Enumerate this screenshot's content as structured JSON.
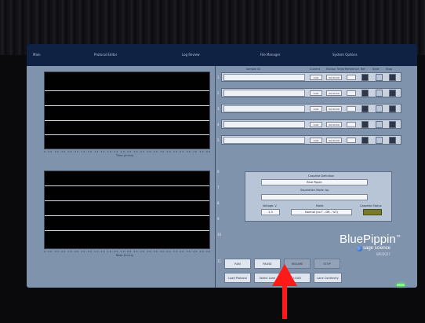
{
  "menu": {
    "items": [
      {
        "label": "Main"
      },
      {
        "label": "Protocol Editor"
      },
      {
        "label": "Log Review"
      },
      {
        "label": "File Manager"
      },
      {
        "label": "System Options"
      }
    ]
  },
  "plots": {
    "top_axis_labels": "0:00 03:20 06:40 10:00 13:20 16:40 20:00 23:20 26:40 30:00 33:20 36:40 40:00",
    "top_axis_title": "Time (h:m:s)",
    "bottom_axis_labels": "0:00 03:20 06:40 10:00 13:20 16:40 20:00 23:20 26:40 30:00 33:20 36:40 40:00",
    "bottom_axis_title": "Base (h:m:s)"
  },
  "lanes": {
    "headers": {
      "sample": "Sample ID",
      "current": "Current",
      "elution": "Elution Timer",
      "reference": "Reference",
      "ref": "Ref",
      "start": "Start",
      "stop": "Stop"
    },
    "numbers": [
      "1",
      "2",
      "3",
      "4",
      "5"
    ],
    "rows": [
      {
        "current": "0.00",
        "timer": "00:00:00"
      },
      {
        "current": "0.00",
        "timer": "00:00:00"
      },
      {
        "current": "0.00",
        "timer": "00:00:00"
      },
      {
        "current": "0.00",
        "timer": "00:00:00"
      },
      {
        "current": "0.00",
        "timer": "00:00:00"
      }
    ]
  },
  "lower_lane_numbers": [
    "6",
    "7",
    "8",
    "9",
    "10",
    "11"
  ],
  "cassette": {
    "title": "Cassette Definition",
    "definition_value": "Blue Pippin",
    "protocol_label": "Separation Mode: bp",
    "voltage_label": "Voltage: V",
    "voltage_value": "1.3",
    "mode_label": "Mode",
    "mode_value": "Normal (no T - DR - %T)",
    "continuity_label": "Cassette Status"
  },
  "buttons": {
    "row1": [
      "RUN",
      "PAUSE",
      "RESUME",
      "STOP"
    ],
    "row2": [
      "Load Protocol",
      "Select Lane",
      "LOAD",
      "Lane Continuity"
    ]
  },
  "brand": {
    "name": "BluePippin",
    "tm": "™",
    "company": "sage science",
    "serial": "BP02027"
  }
}
